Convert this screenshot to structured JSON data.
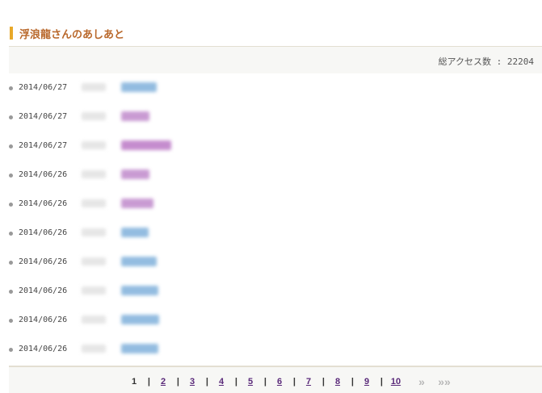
{
  "title": "浮浪龍さんのあしあと",
  "total_access": "総アクセス数 : 22204",
  "rows": [
    {
      "date": "2014/06/27",
      "name_color": "#6fa6d6",
      "name_width": 44
    },
    {
      "date": "2014/06/27",
      "name_color": "#b779c4",
      "name_width": 35
    },
    {
      "date": "2014/06/27",
      "name_color": "#b266be",
      "name_width": 62
    },
    {
      "date": "2014/06/26",
      "name_color": "#b779c4",
      "name_width": 35
    },
    {
      "date": "2014/06/26",
      "name_color": "#b779c4",
      "name_width": 40
    },
    {
      "date": "2014/06/26",
      "name_color": "#6fa6d6",
      "name_width": 34
    },
    {
      "date": "2014/06/26",
      "name_color": "#6fa6d6",
      "name_width": 44
    },
    {
      "date": "2014/06/26",
      "name_color": "#6fa6d6",
      "name_width": 46
    },
    {
      "date": "2014/06/26",
      "name_color": "#6fa6d6",
      "name_width": 47
    },
    {
      "date": "2014/06/26",
      "name_color": "#6fa6d6",
      "name_width": 46
    }
  ],
  "pager": {
    "current": "1",
    "pages": [
      "2",
      "3",
      "4",
      "5",
      "6",
      "7",
      "8",
      "9",
      "10"
    ],
    "separator": "|",
    "next": "»",
    "last": "»»"
  }
}
